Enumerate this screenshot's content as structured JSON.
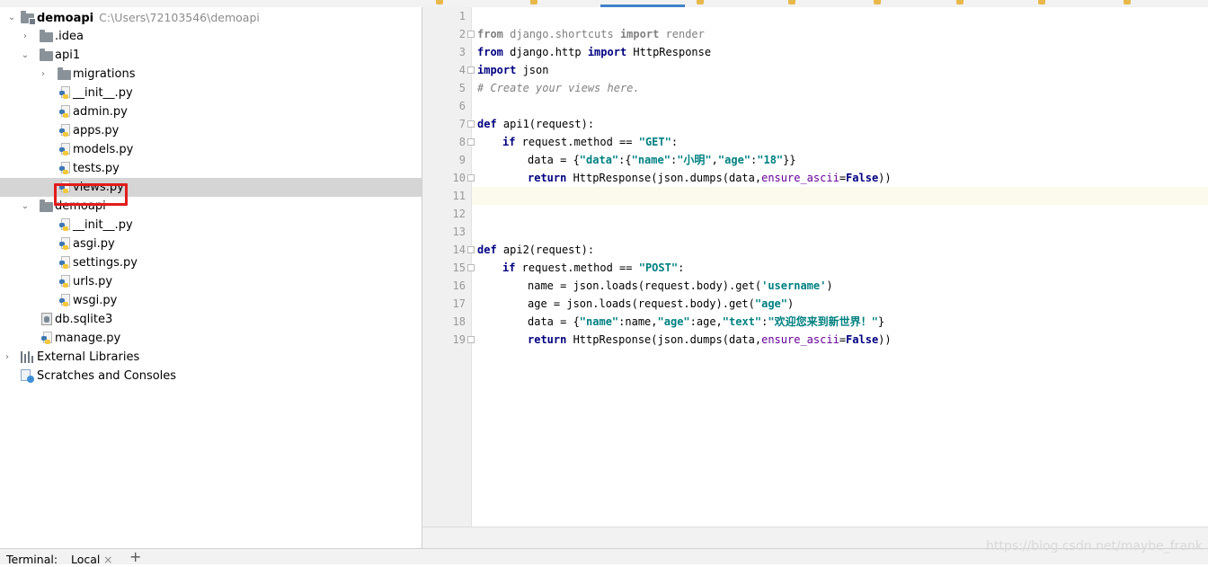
{
  "project_tree": {
    "root_name": "demoapi",
    "root_path": "C:\\Users\\72103546\\demoapi",
    "items": [
      {
        "label": ".idea"
      },
      {
        "label": "api1"
      },
      {
        "label": "migrations"
      },
      {
        "label": "__init__.py"
      },
      {
        "label": "admin.py"
      },
      {
        "label": "apps.py"
      },
      {
        "label": "models.py"
      },
      {
        "label": "tests.py"
      },
      {
        "label": "views.py"
      },
      {
        "label": "demoapi"
      },
      {
        "label": "__init__.py"
      },
      {
        "label": "asgi.py"
      },
      {
        "label": "settings.py"
      },
      {
        "label": "urls.py"
      },
      {
        "label": "wsgi.py"
      },
      {
        "label": "db.sqlite3"
      },
      {
        "label": "manage.py"
      },
      {
        "label": "External Libraries"
      },
      {
        "label": "Scratches and Consoles"
      }
    ]
  },
  "editor": {
    "line_numbers": [
      "1",
      "2",
      "3",
      "4",
      "5",
      "6",
      "7",
      "8",
      "9",
      "10",
      "11",
      "12",
      "13",
      "14",
      "15",
      "16",
      "17",
      "18",
      "19"
    ],
    "tokens": {
      "l2": [
        "from",
        " django.shortcuts ",
        "import",
        " render"
      ],
      "l3": [
        "from",
        " django.http ",
        "import",
        " HttpResponse"
      ],
      "l4": [
        "import",
        " json"
      ],
      "l5": [
        "# Create your views here."
      ],
      "l7": [
        "def",
        " api1(",
        "request",
        "):"
      ],
      "l8": [
        "if",
        " request.method == ",
        "\"GET\"",
        ":"
      ],
      "l9": [
        "data = {",
        "\"data\"",
        ":{",
        "\"name\"",
        ":",
        "\"小明\"",
        ",",
        "\"age\"",
        ":",
        "\"18\"",
        "}}"
      ],
      "l10": [
        "return",
        " HttpResponse(json.dumps(data,",
        "ensure_ascii",
        "=",
        "False",
        "))"
      ],
      "l14": [
        "def",
        " api2(",
        "request",
        "):"
      ],
      "l15": [
        "if",
        " request.method == ",
        "\"POST\"",
        ":"
      ],
      "l16": [
        "name = json.loads(request.body).get(",
        "'username'",
        ")"
      ],
      "l17": [
        "age = json.loads(request.body).get(",
        "\"age\"",
        ")"
      ],
      "l18": [
        "data = {",
        "\"name\"",
        ":name,",
        "\"age\"",
        ":age,",
        "\"text\"",
        ":",
        "\"欢迎您来到新世界！\"",
        "}"
      ],
      "l19": [
        "return",
        " HttpResponse(json.dumps(data,",
        "ensure_ascii",
        "=",
        "False",
        "))"
      ]
    }
  },
  "terminal": {
    "title": "Terminal:",
    "tab": "Local",
    "close": "×",
    "add": "+"
  },
  "watermark": "https://blog.csdn.net/maybe_frank",
  "colors": {
    "keyword": "#000080",
    "string": "#008080",
    "comment": "#808080",
    "selection": "#d5d5d5",
    "highlight_box": "#e21c1c",
    "current_line": "#fcfaed"
  }
}
